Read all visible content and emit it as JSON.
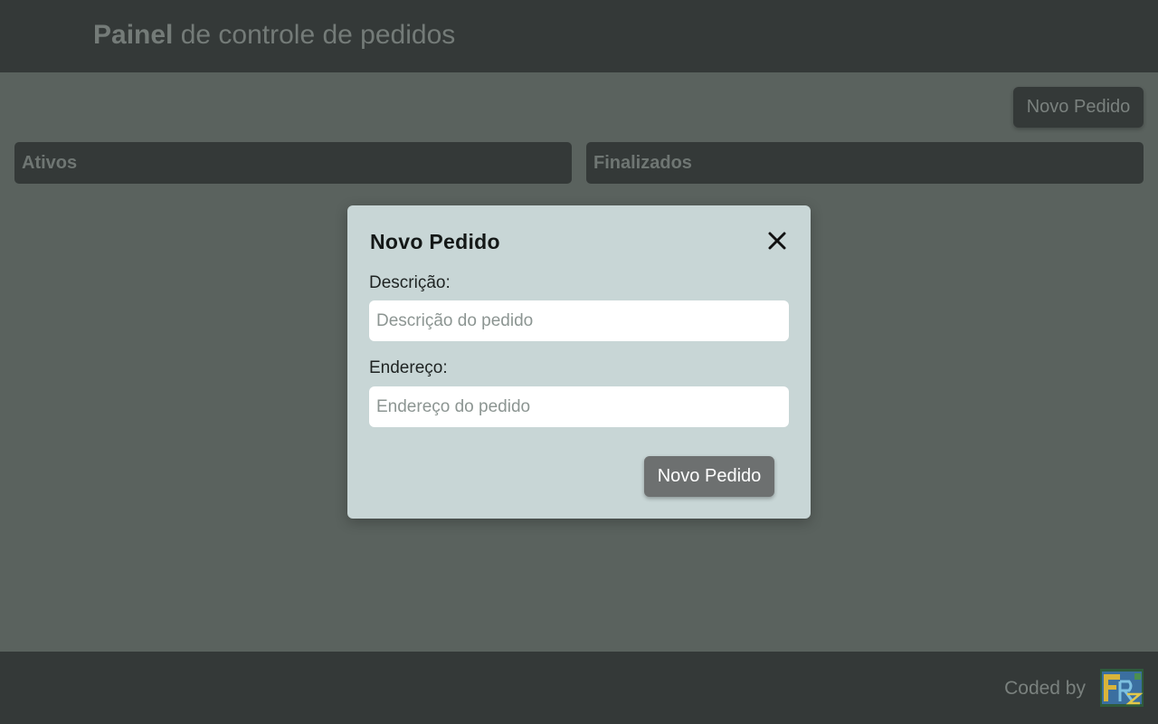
{
  "header": {
    "title_bold": "Painel",
    "title_rest": " de controle de pedidos"
  },
  "toolbar": {
    "new_order_label": "Novo Pedido"
  },
  "columns": [
    {
      "label": "Ativos"
    },
    {
      "label": "Finalizados"
    }
  ],
  "modal": {
    "title": "Novo Pedido",
    "close_icon": "close-icon",
    "description_label": "Descrição:",
    "description_placeholder": "Descrição do pedido",
    "description_value": "",
    "address_label": "Endereço:",
    "address_placeholder": "Endereço do pedido",
    "address_value": "",
    "submit_label": "Novo Pedido"
  },
  "footer": {
    "credit_text": "Coded by",
    "logo_icon": "author-logo-icon"
  },
  "colors": {
    "header_bg": "#343938",
    "page_bg": "#5a625e",
    "modal_bg": "#c8d6d6",
    "submit_bg": "#6d7070"
  }
}
